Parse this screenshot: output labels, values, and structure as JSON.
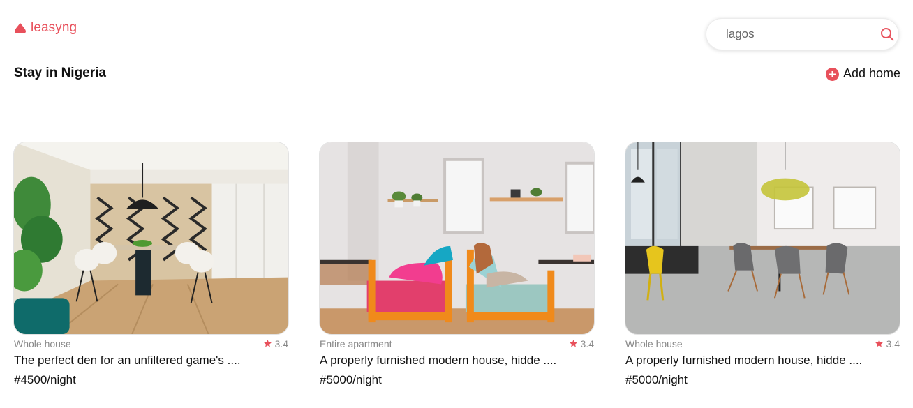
{
  "brand": {
    "name": "leasyng",
    "accent": "#e8505b"
  },
  "search": {
    "value": "lagos",
    "icon": "search-icon"
  },
  "page": {
    "title": "Stay in Nigeria"
  },
  "actions": {
    "add_home_label": "Add home",
    "add_icon": "plus-circle-icon"
  },
  "listings": [
    {
      "type": "Whole house",
      "rating": "3.4",
      "title": "The perfect den for an unfiltered game's ....",
      "price": "#4500/night"
    },
    {
      "type": "Entire apartment",
      "rating": "3.4",
      "title": "A properly furnished modern house, hidde ....",
      "price": "#5000/night"
    },
    {
      "type": "Whole house",
      "rating": "3.4",
      "title": "A properly furnished modern house, hidde ....",
      "price": "#5000/night"
    }
  ]
}
